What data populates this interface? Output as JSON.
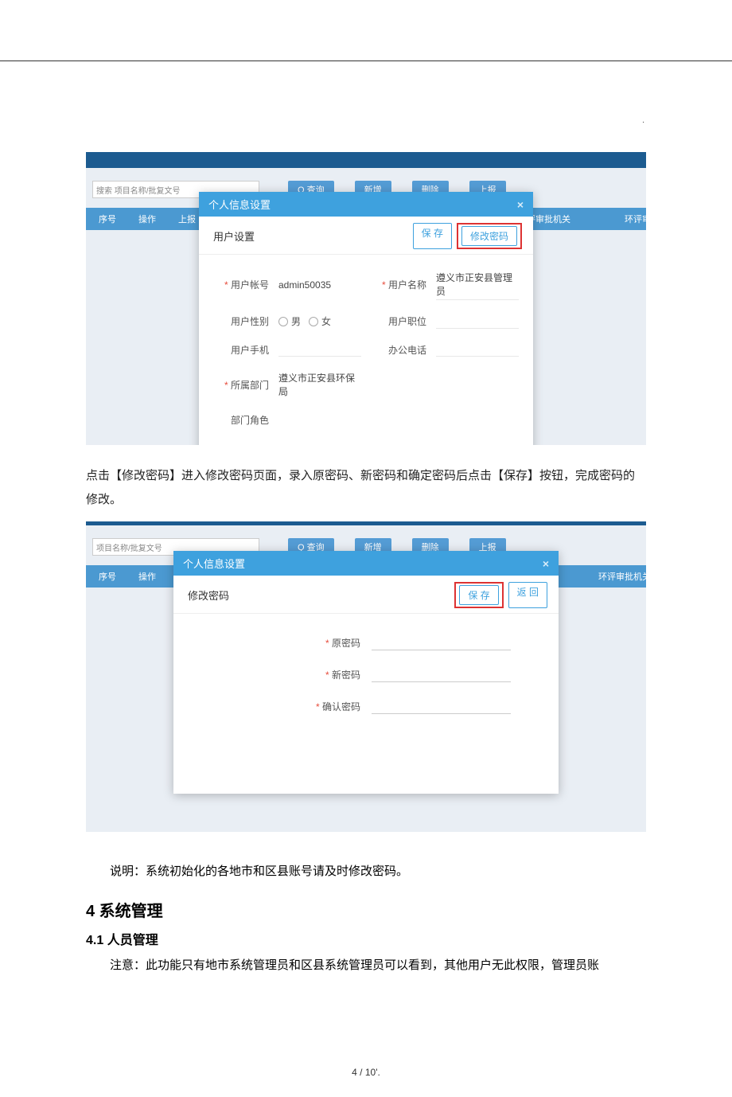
{
  "bg": {
    "search_placeholder": "搜索 项目名称/批复文号",
    "search_placeholder2": "项目名称/批复文号",
    "btn_query": "Q 查询",
    "btn_new": "新增",
    "btn_del": "删除",
    "btn_report": "上报",
    "thead": [
      "序号",
      "操作",
      "上报"
    ],
    "thead_right1": "环评审批机关",
    "thead_right2": "环评审"
  },
  "modal1": {
    "title": "个人信息设置",
    "section": "用户设置",
    "save": "保 存",
    "change_pwd": "修改密码",
    "fields": {
      "account_label": "用户帐号",
      "account_value": "admin50035",
      "username_label": "用户名称",
      "username_value": "遵义市正安县管理员",
      "gender_label": "用户性别",
      "gender_m": "男",
      "gender_f": "女",
      "position_label": "用户职位",
      "mobile_label": "用户手机",
      "office_phone_label": "办公电话",
      "dept_label": "所属部门",
      "dept_value": "遵义市正安县环保局",
      "role_label": "部门角色"
    }
  },
  "para1": "点击【修改密码】进入修改密码页面，录入原密码、新密码和确定密码后点击【保存】按钮，完成密码的修改。",
  "modal2": {
    "title": "个人信息设置",
    "section": "修改密码",
    "save": "保 存",
    "back": "返 回",
    "old_pwd": "原密码",
    "new_pwd": "新密码",
    "confirm_pwd": "确认密码"
  },
  "note": "说明：系统初始化的各地市和区县账号请及时修改密码。",
  "heading4": "4  系统管理",
  "heading41": "4.1 人员管理",
  "body41": "注意：此功能只有地市系统管理员和区县系统管理员可以看到，其他用户无此权限，管理员账",
  "footer": "4  / 10'."
}
